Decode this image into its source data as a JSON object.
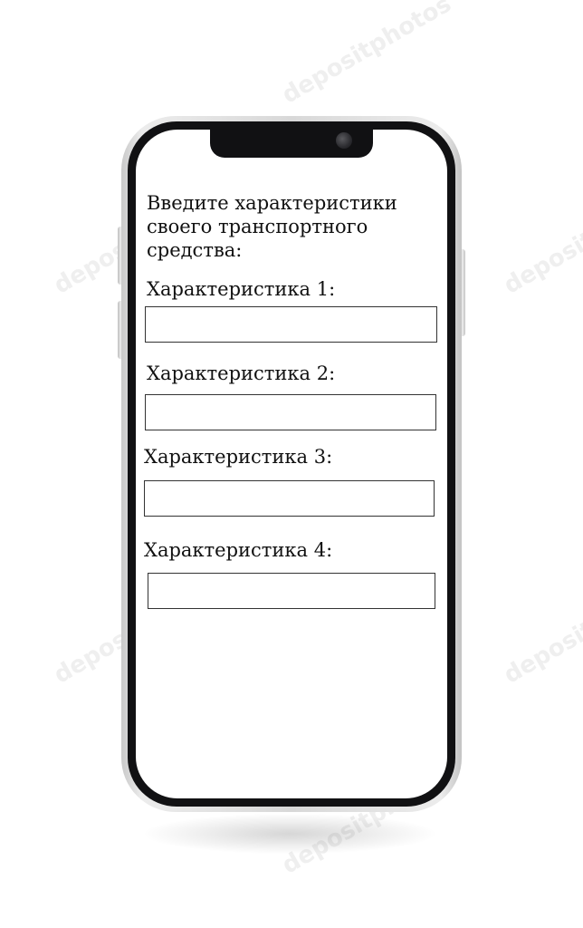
{
  "form": {
    "title": "Введите характеристики своего транспортного средства:",
    "fields": [
      {
        "label": "Характеристика 1:",
        "value": ""
      },
      {
        "label": "Характеристика 2:",
        "value": ""
      },
      {
        "label": "Характеристика 3:",
        "value": ""
      },
      {
        "label": "Характеристика 4:",
        "value": ""
      }
    ]
  },
  "watermark": {
    "text": "depositphotos"
  },
  "device": {
    "frame_color": "#d8d8d8",
    "bezel_color": "#111113",
    "screen_color": "#ffffff"
  }
}
